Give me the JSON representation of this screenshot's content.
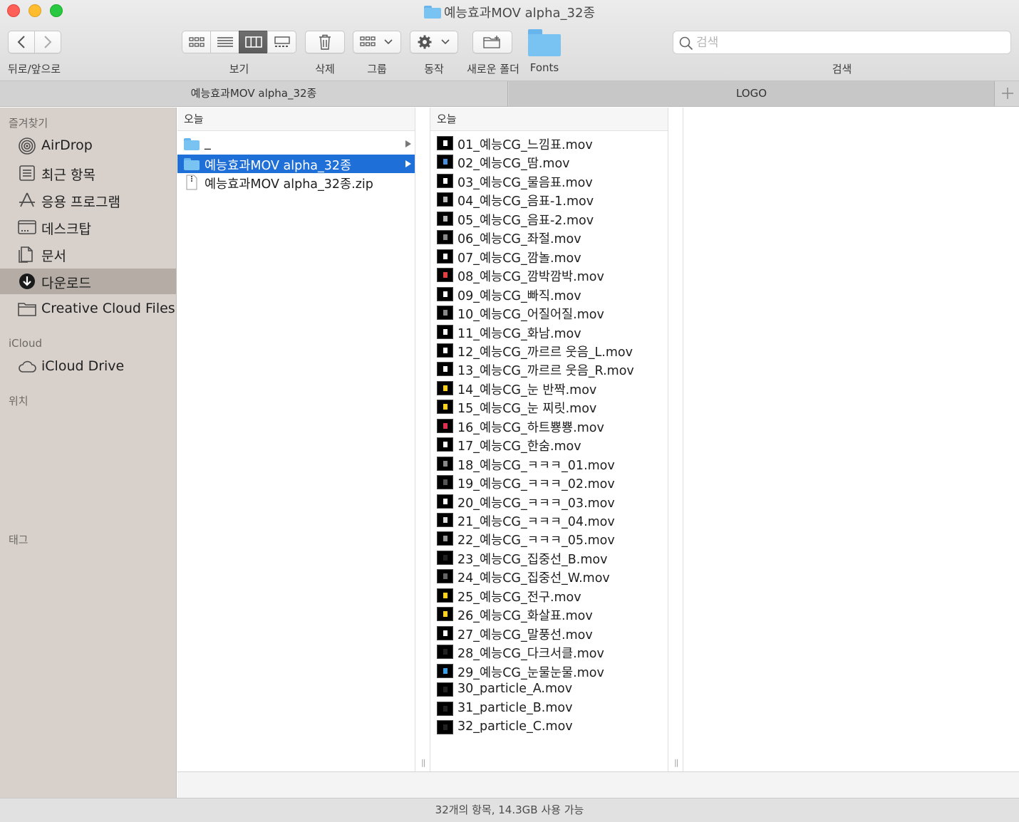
{
  "window": {
    "title": "예능효과MOV alpha_32종"
  },
  "toolbar": {
    "back_forward_label": "뒤로/앞으로",
    "view_label": "보기",
    "delete_label": "삭제",
    "group_label": "그룹",
    "action_label": "동작",
    "new_folder_label": "새로운 폴더",
    "fonts_label": "Fonts",
    "search_label": "검색",
    "search_placeholder": "검색"
  },
  "tabs": [
    {
      "label": "예능효과MOV alpha_32종",
      "active": true
    },
    {
      "label": "LOGO",
      "active": false
    }
  ],
  "sidebar": {
    "favorites_header": "즐겨찾기",
    "favorites": [
      {
        "label": "AirDrop",
        "icon": "airdrop-icon"
      },
      {
        "label": "최근 항목",
        "icon": "recents-icon"
      },
      {
        "label": "응용 프로그램",
        "icon": "applications-icon"
      },
      {
        "label": "데스크탑",
        "icon": "desktop-icon"
      },
      {
        "label": "문서",
        "icon": "documents-icon"
      },
      {
        "label": "다운로드",
        "icon": "downloads-icon",
        "selected": true
      },
      {
        "label": "Creative Cloud Files",
        "icon": "folder-icon"
      }
    ],
    "icloud_header": "iCloud",
    "icloud": [
      {
        "label": "iCloud Drive",
        "icon": "cloud-icon"
      }
    ],
    "locations_header": "위치",
    "tags_header": "태그"
  },
  "columns": {
    "col1": {
      "header": "오늘",
      "items": [
        {
          "label": "_",
          "kind": "folder",
          "arrow": true
        },
        {
          "label": "예능효과MOV alpha_32종",
          "kind": "folder",
          "arrow": true,
          "selected": true
        },
        {
          "label": "예능효과MOV alpha_32종.zip",
          "kind": "zip",
          "arrow": false
        }
      ]
    },
    "col2": {
      "header": "오늘",
      "items": [
        {
          "label": "01_예능CG_느낌표.mov",
          "mark": "#ffffff"
        },
        {
          "label": "02_예능CG_땀.mov",
          "mark": "#4a8fd8"
        },
        {
          "label": "03_예능CG_물음표.mov",
          "mark": "#ffffff"
        },
        {
          "label": "04_예능CG_음표-1.mov",
          "mark": "#bbbbbb"
        },
        {
          "label": "05_예능CG_음표-2.mov",
          "mark": "#bbbbbb"
        },
        {
          "label": "06_예능CG_좌절.mov",
          "mark": "#888888"
        },
        {
          "label": "07_예능CG_깜놀.mov",
          "mark": "#ffffff"
        },
        {
          "label": "08_예능CG_깜박깜박.mov",
          "mark": "#e04040"
        },
        {
          "label": "09_예능CG_빠직.mov",
          "mark": "#ffffff"
        },
        {
          "label": "10_예능CG_어질어질.mov",
          "mark": "#888888"
        },
        {
          "label": "11_예능CG_화남.mov",
          "mark": "#ffffff"
        },
        {
          "label": "12_예능CG_까르르 웃음_L.mov",
          "mark": "#ffffff"
        },
        {
          "label": "13_예능CG_까르르 웃음_R.mov",
          "mark": "#ffffff"
        },
        {
          "label": "14_예능CG_눈 반짝.mov",
          "mark": "#ffd21f"
        },
        {
          "label": "15_예능CG_눈 찌릿.mov",
          "mark": "#ffd21f"
        },
        {
          "label": "16_예능CG_하트뿅뿅.mov",
          "mark": "#e03050"
        },
        {
          "label": "17_예능CG_한숨.mov",
          "mark": "#ffffff"
        },
        {
          "label": "18_예능CG_ㅋㅋㅋ_01.mov",
          "mark": "#888888"
        },
        {
          "label": "19_예능CG_ㅋㅋㅋ_02.mov",
          "mark": "#555555"
        },
        {
          "label": "20_예능CG_ㅋㅋㅋ_03.mov",
          "mark": "#ffffff"
        },
        {
          "label": "21_예능CG_ㅋㅋㅋ_04.mov",
          "mark": "#dddddd"
        },
        {
          "label": "22_예능CG_ㅋㅋㅋ_05.mov",
          "mark": "#999999"
        },
        {
          "label": "23_예능CG_집중선_B.mov",
          "mark": "#222222"
        },
        {
          "label": "24_예능CG_집중선_W.mov",
          "mark": "#666666"
        },
        {
          "label": "25_예능CG_전구.mov",
          "mark": "#ffd21f"
        },
        {
          "label": "26_예능CG_화살표.mov",
          "mark": "#ffd21f"
        },
        {
          "label": "27_예능CG_말풍선.mov",
          "mark": "#ffffff"
        },
        {
          "label": "28_예능CG_다크서클.mov",
          "mark": "#222222"
        },
        {
          "label": "29_예능CG_눈물눈물.mov",
          "mark": "#3aa0e8"
        },
        {
          "label": "30_particle_A.mov",
          "mark": "#222222"
        },
        {
          "label": "31_particle_B.mov",
          "mark": "#222222"
        },
        {
          "label": "32_particle_C.mov",
          "mark": "#222222"
        }
      ]
    }
  },
  "status": {
    "text": "32개의 항목, 14.3GB 사용 가능"
  },
  "colors": {
    "selection": "#1f6fd9",
    "sidebar_selection": "#b4aca5",
    "folder": "#79c3f2"
  }
}
